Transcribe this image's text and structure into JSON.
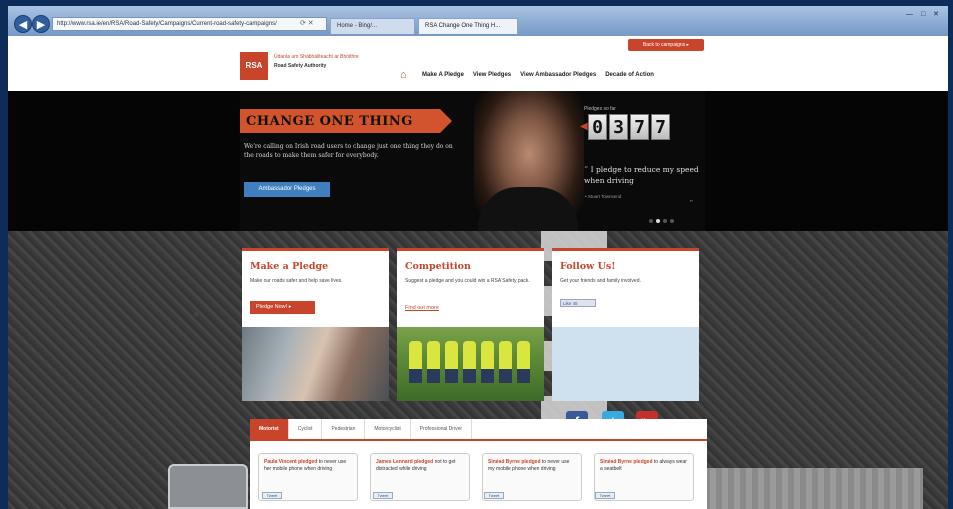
{
  "browser": {
    "address": "http://www.rsa.ie/en/RSA/Road-Safety/Campaigns/Current-road-safety-campaigns/",
    "tabs": [
      "Home - Bing/...",
      "RSA Change One Thing H..."
    ],
    "window_controls": "— □ ✕"
  },
  "header": {
    "logo_text": "RSA",
    "logo_tagline": "Údarás um Shábháilteacht ar Bhóithre",
    "logo_name": "Road Safety Authority",
    "back_button": "Back to campaigns ▸",
    "nav": [
      "Make A Pledge",
      "View Pledges",
      "View Ambassador Pledges",
      "Decade of Action"
    ]
  },
  "hero": {
    "banner": "CHANGE ONE THING",
    "text": "We're calling on Irish road users to change just one thing they do on the roads to make them safer for everybody.",
    "ambassador_button": "Ambassador Pledges",
    "pledges_label": "Pledges so far",
    "counter": [
      "0",
      "3",
      "7",
      "7"
    ],
    "quote": "I pledge to reduce my speed when driving",
    "quote_author": "• Stuart Townsend"
  },
  "cards": {
    "pledge": {
      "title": "Make a Pledge",
      "text": "Make our roads safer and help save lives.",
      "button": "Pledge Now! ▸"
    },
    "competition": {
      "title": "Competition",
      "text": "Suggest a pledge and you could win a RSA Safety pack.",
      "link": "Find out more"
    },
    "follow": {
      "title": "Follow Us!",
      "text": "Get your friends and family involved.",
      "like": "Like  45"
    }
  },
  "panel": {
    "tabs": [
      "Motorist",
      "Cyclist",
      "Pedestrian",
      "Motorcyclist",
      "Professional Driver"
    ],
    "tiles": [
      {
        "who": "Paula Vincent pledged",
        "what": " to never use her mobile phone when driving"
      },
      {
        "who": "James Lennard pledged",
        "what": " not to get distracted while driving"
      },
      {
        "who": "Sinéad Byrne pledged",
        "what": " to never use my mobile phone when driving"
      },
      {
        "who": "Sinéad Byrne pledged",
        "what": " to always wear a seatbelt"
      }
    ],
    "tweet_label": "Tweet"
  }
}
